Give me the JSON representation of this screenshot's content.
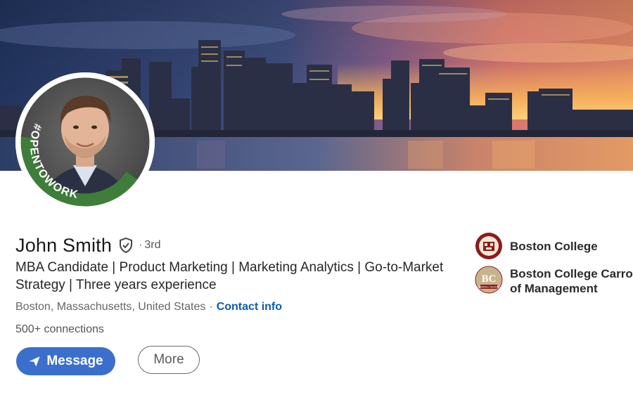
{
  "profile": {
    "name": "John Smith",
    "degree_separator": "·",
    "degree": "3rd",
    "headline": "MBA Candidate | Product Marketing | Marketing Analytics | Go-to-Market Strategy | Three years experience",
    "location": "Boston, Massachusetts, United States",
    "location_separator": "·",
    "contact_info_label": "Contact info",
    "connections": "500+ connections",
    "open_to_work_badge": "#OPENTOWORK"
  },
  "actions": {
    "message_label": "Message",
    "more_label": "More"
  },
  "education": [
    {
      "name_line1": "Boston College",
      "name_line2": ""
    },
    {
      "name_line1": "Boston College Carroll",
      "name_line2": "of Management",
      "logo_text": "BC",
      "logo_subtext": "CARROLL SCHOOL"
    }
  ],
  "colors": {
    "primary_button": "#3b6fcb",
    "link": "#0a5bb5",
    "open_to_work_green": "#3e7d3a"
  },
  "icons": {
    "verify": "shield-check-icon",
    "send": "paper-plane-icon"
  }
}
